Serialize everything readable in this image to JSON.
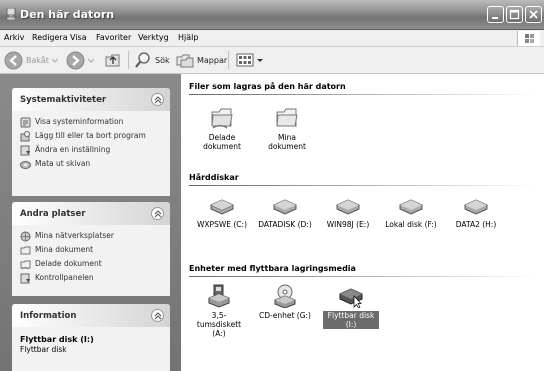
{
  "window": {
    "title": "Den här datorn"
  },
  "menu": [
    "Arkiv",
    "Redigera",
    "Visa",
    "Favoriter",
    "Verktyg",
    "Hjälp"
  ],
  "toolbar": {
    "back": "Bakåt",
    "search": "Sök",
    "folders": "Mappar"
  },
  "panels": {
    "system": {
      "title": "Systemaktiviteter",
      "items": [
        "Visa systeminformation",
        "Lägg till eller ta bort program",
        "Ändra en inställning",
        "Mata ut skivan"
      ]
    },
    "places": {
      "title": "Andra platser",
      "items": [
        "Mina nätverksplatser",
        "Mina dokument",
        "Delade dokument",
        "Kontrollpanelen"
      ]
    },
    "info": {
      "title": "Information",
      "name": "Flyttbar disk (I:)",
      "type": "Flyttbar disk"
    }
  },
  "groups": {
    "files": {
      "title": "Filer som lagras på den här datorn",
      "items": [
        "Delade dokument",
        "Mina dokument"
      ]
    },
    "disks": {
      "title": "Hårddiskar",
      "items": [
        "WXPSWE (C:)",
        "DATADISK (D:)",
        "WIN98J (E:)",
        "Lokal disk (F:)",
        "DATA2 (H:)"
      ]
    },
    "removable": {
      "title": "Enheter med flyttbara lagringsmedia",
      "items": [
        "3,5-tumsdiskett (A:)",
        "CD-enhet (G:)",
        "Flyttbar disk (I:)"
      ]
    }
  }
}
